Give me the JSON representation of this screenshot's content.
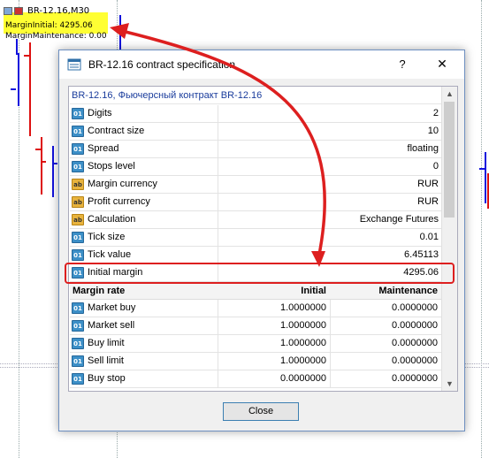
{
  "chart": {
    "title": "BR-12.16,M30",
    "indicators": [
      "MarginInitial: 4295.06",
      "MarginMaintenance: 0.00"
    ]
  },
  "dialog": {
    "title": "BR-12.16 contract specification",
    "help": "?",
    "close_x": "✕",
    "group_title": "BR-12.16, Фьючерсный контракт BR-12.16",
    "properties": [
      {
        "icon": "01",
        "icon_type": "num",
        "name": "Digits",
        "value": "2"
      },
      {
        "icon": "01",
        "icon_type": "num",
        "name": "Contract size",
        "value": "10"
      },
      {
        "icon": "01",
        "icon_type": "num",
        "name": "Spread",
        "value": "floating"
      },
      {
        "icon": "01",
        "icon_type": "num",
        "name": "Stops level",
        "value": "0"
      },
      {
        "icon": "ab",
        "icon_type": "ab",
        "name": "Margin currency",
        "value": "RUR"
      },
      {
        "icon": "ab",
        "icon_type": "ab",
        "name": "Profit currency",
        "value": "RUR"
      },
      {
        "icon": "ab",
        "icon_type": "ab",
        "name": "Calculation",
        "value": "Exchange Futures"
      },
      {
        "icon": "01",
        "icon_type": "num",
        "name": "Tick size",
        "value": "0.01"
      },
      {
        "icon": "01",
        "icon_type": "num",
        "name": "Tick value",
        "value": "6.45113"
      },
      {
        "icon": "01",
        "icon_type": "num",
        "name": "Initial margin",
        "value": "4295.06"
      }
    ],
    "rate_header": {
      "name": "Margin rate",
      "initial": "Initial",
      "maintenance": "Maintenance"
    },
    "rates": [
      {
        "name": "Market buy",
        "initial": "1.0000000",
        "maintenance": "0.0000000"
      },
      {
        "name": "Market sell",
        "initial": "1.0000000",
        "maintenance": "0.0000000"
      },
      {
        "name": "Buy limit",
        "initial": "1.0000000",
        "maintenance": "0.0000000"
      },
      {
        "name": "Sell limit",
        "initial": "1.0000000",
        "maintenance": "0.0000000"
      },
      {
        "name": "Buy stop",
        "initial": "0.0000000",
        "maintenance": "0.0000000"
      }
    ],
    "close_button": "Close"
  },
  "colors": {
    "highlight": "#dd1f1f",
    "indicator_bg": "#ffff33",
    "bull_bar": "#1111dd",
    "bear_bar": "#dd1111",
    "group_title": "#1a3c9c"
  }
}
